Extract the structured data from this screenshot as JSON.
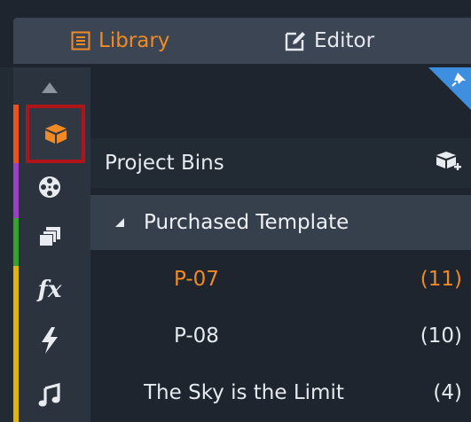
{
  "tabs": {
    "library_label": "Library",
    "editor_label": "Editor"
  },
  "rail": {
    "strip_colors": [
      "#e8531e",
      "#9b3fc4",
      "#36a12f",
      "#e0b40c"
    ],
    "icons": [
      "up-arrow-icon",
      "library-box-icon",
      "media-reel-icon",
      "stack-icon",
      "fx-icon",
      "flash-icon",
      "music-note-icon"
    ],
    "fx_label": "fx"
  },
  "panel": {
    "bins_title": "Project Bins",
    "group_label": "Purchased Template",
    "items": [
      {
        "label": "P-07",
        "count": "(11)"
      },
      {
        "label": "P-08",
        "count": "(10)"
      },
      {
        "label": "The Sky is the Limit",
        "count": "(4)"
      }
    ]
  },
  "colors": {
    "accent": "#f08a24",
    "highlight_border": "#b0141b",
    "pin_corner": "#3f8fe0"
  }
}
